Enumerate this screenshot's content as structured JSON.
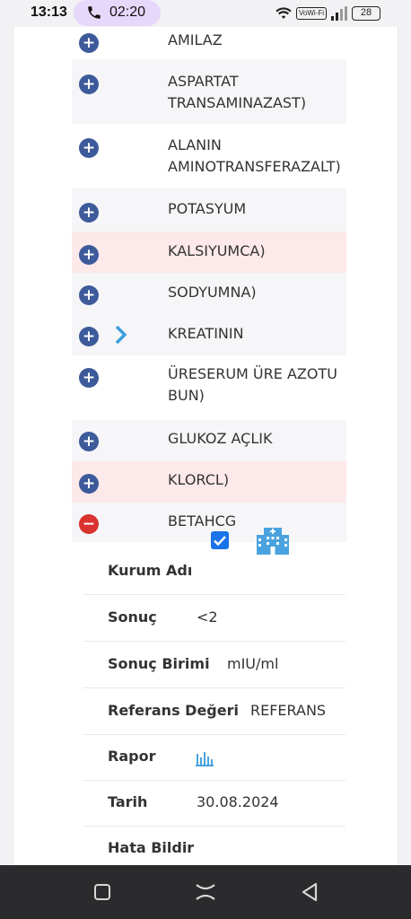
{
  "status_bar": {
    "time": "13:13",
    "call_timer": "02:20",
    "network_badge": "VoWi-Fi",
    "battery": "28"
  },
  "tests": [
    {
      "name_line1": "AMILAZ",
      "name_line2": "",
      "style": "white",
      "expanded": false
    },
    {
      "name_line1": "ASPARTAT",
      "name_line2": "TRANSAMINAZAST)",
      "style": "odd",
      "expanded": false
    },
    {
      "name_line1": "ALANIN",
      "name_line2": "AMINOTRANSFERAZALT)",
      "style": "white",
      "expanded": false
    },
    {
      "name_line1": "POTASYUM",
      "name_line2": "",
      "style": "odd",
      "expanded": false
    },
    {
      "name_line1": "KALSIYUMCA)",
      "name_line2": "",
      "style": "alert",
      "expanded": false
    },
    {
      "name_line1": "SODYUMNA)",
      "name_line2": "",
      "style": "odd",
      "expanded": false
    },
    {
      "name_line1": "KREATININ",
      "name_line2": "",
      "style": "odd",
      "expanded": false
    },
    {
      "name_line1": "ÜRESERUM ÜRE AZOTU",
      "name_line2": "BUN)",
      "style": "white",
      "expanded": false
    },
    {
      "name_line1": "GLUKOZ AÇLIK",
      "name_line2": "",
      "style": "odd",
      "expanded": false
    },
    {
      "name_line1": "KLORCL)",
      "name_line2": "",
      "style": "alert",
      "expanded": false
    },
    {
      "name_line1": "BETAHCG",
      "name_line2": "",
      "style": "odd",
      "expanded": true
    }
  ],
  "detail": {
    "institution_label": "Kurum Adı",
    "institution_checked": true,
    "result_label": "Sonuç",
    "result_value": "<2",
    "unit_label": "Sonuç Birimi",
    "unit_value": "mIU/ml",
    "reference_label": "Referans Değeri",
    "reference_value": "REFERANS",
    "report_label": "Rapor",
    "date_label": "Tarih",
    "date_value": "30.08.2024",
    "report_error_label": "Hata Bildir"
  },
  "colors": {
    "plus_button": "#3d5a9a",
    "minus_button": "#d9322f",
    "alert_row": "#fde9ea",
    "checkbox": "#1a73e8",
    "icon_blue": "#4aa3df"
  },
  "icons": [
    "phone-icon",
    "wifi-icon",
    "signal-icon",
    "battery-icon",
    "plus-icon",
    "minus-icon",
    "chevron-right-icon",
    "checkbox-icon",
    "hospital-icon",
    "bar-chart-icon",
    "recent-apps-icon",
    "home-icon",
    "back-icon"
  ]
}
